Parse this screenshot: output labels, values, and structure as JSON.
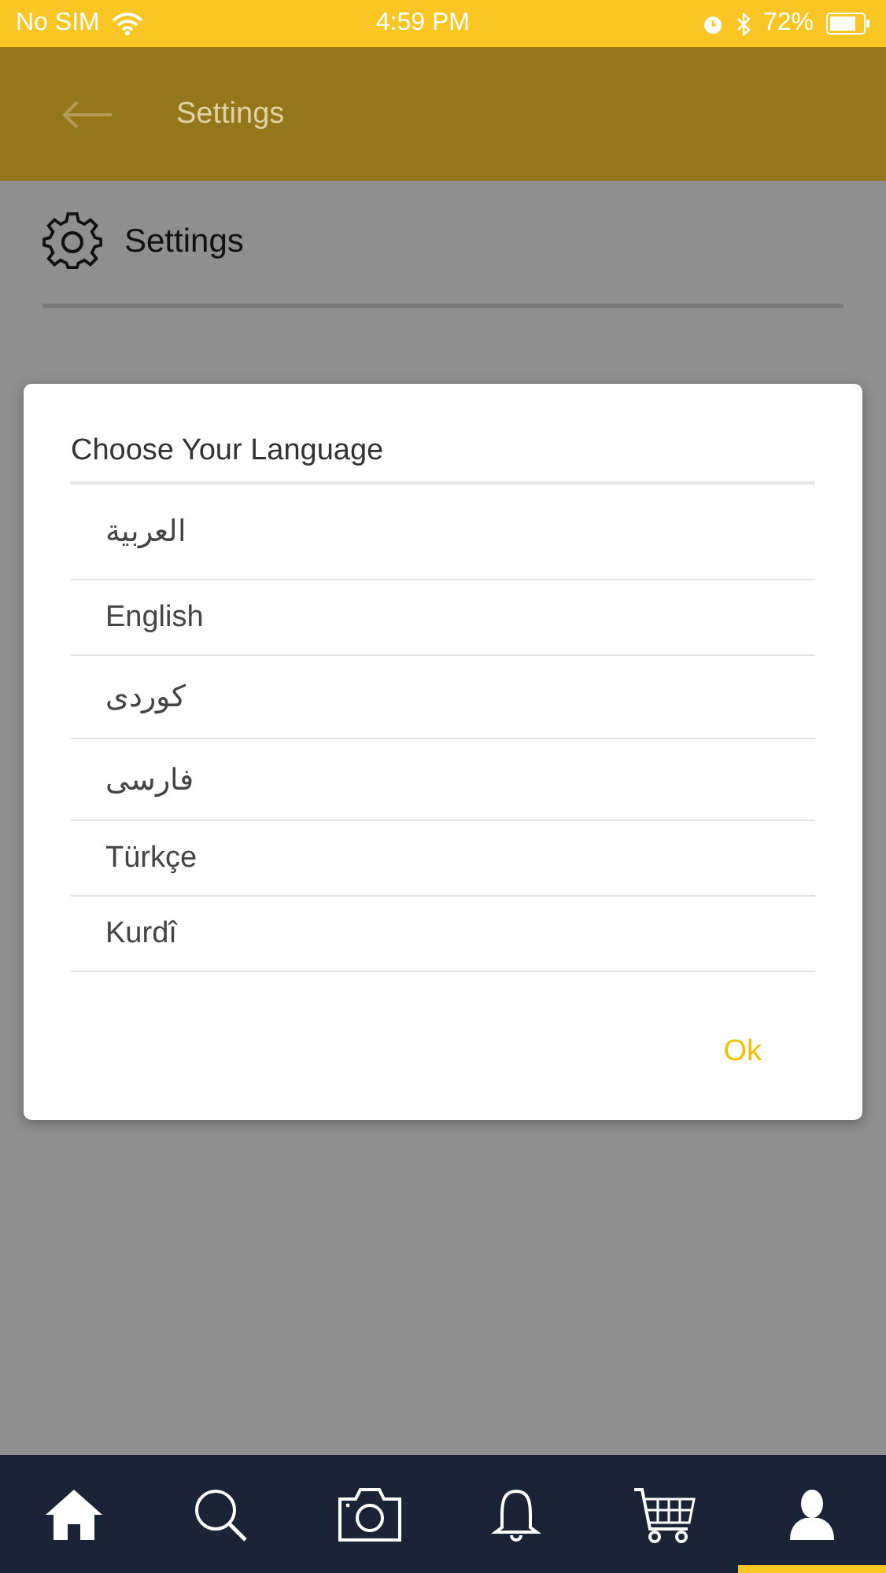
{
  "status_bar": {
    "carrier": "No SIM",
    "time": "4:59 PM",
    "battery": "72%"
  },
  "header": {
    "title": "Settings"
  },
  "section": {
    "title": "Settings"
  },
  "dialog": {
    "title": "Choose Your Language",
    "options": [
      {
        "label": "العربية"
      },
      {
        "label": "English"
      },
      {
        "label": "کوردی"
      },
      {
        "label": "فارسی"
      },
      {
        "label": "Türkçe"
      },
      {
        "label": "Kurdî"
      }
    ],
    "ok": "Ok"
  },
  "tab_bar": [
    {
      "kind": "home",
      "selected": false
    },
    {
      "kind": "search",
      "selected": false
    },
    {
      "kind": "camera",
      "selected": false
    },
    {
      "kind": "bell",
      "selected": false
    },
    {
      "kind": "cart",
      "selected": false
    },
    {
      "kind": "user",
      "selected": true
    }
  ]
}
